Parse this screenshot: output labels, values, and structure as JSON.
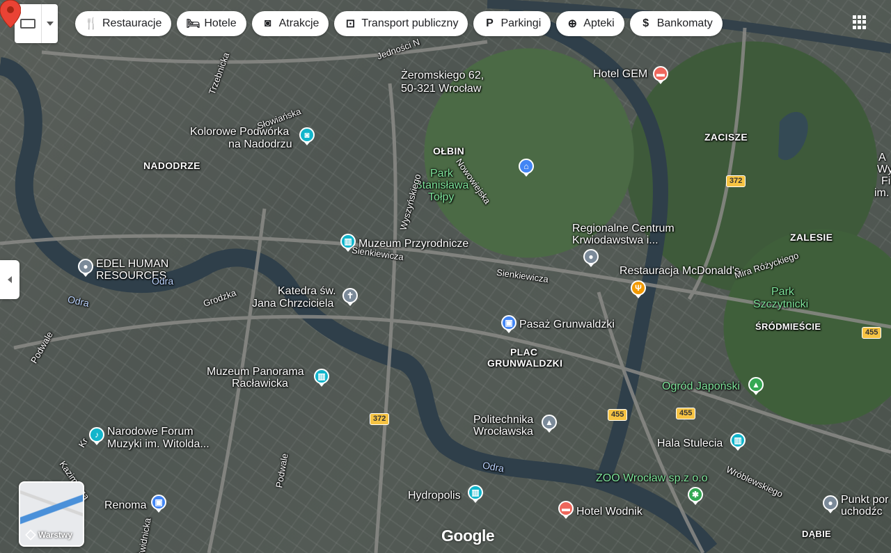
{
  "toolbar": {
    "chips": [
      {
        "label": "Restauracje",
        "icon": "fork-knife-icon",
        "glyph": "🍴"
      },
      {
        "label": "Hotele",
        "icon": "bed-icon",
        "glyph": "🛏"
      },
      {
        "label": "Atrakcje",
        "icon": "camera-icon",
        "glyph": "◙"
      },
      {
        "label": "Transport publiczny",
        "icon": "bus-icon",
        "glyph": "⊡"
      },
      {
        "label": "Parkingi",
        "icon": "parking-icon",
        "glyph": "P"
      },
      {
        "label": "Apteki",
        "icon": "pharmacy-icon",
        "glyph": "⊕"
      },
      {
        "label": "Bankomaty",
        "icon": "atm-icon",
        "glyph": "$"
      }
    ]
  },
  "pin": {
    "line1": "Żeromskiego 62,",
    "line2": "50-321 Wrocław"
  },
  "districts": {
    "nadodrze": "NADODRZE",
    "olbin": "OŁBIN",
    "zacisze": "ZACISZE",
    "zalesie": "ZALESIE",
    "plac1": "PLAC",
    "plac2": "GRUNWALDZKI",
    "srodmiescie": "ŚRÓDMIEŚCIE",
    "dabie": "DĄBIE"
  },
  "places": {
    "hotel_gem": "Hotel GEM",
    "kolorowe1": "Kolorowe Podwórka",
    "kolorowe2": "na Nadodrzu",
    "park_tolpy1": "Park",
    "park_tolpy2": "Stanisława",
    "park_tolpy3": "Tołpy",
    "rckik1": "Regionalne Centrum",
    "rckik2": "Krwiodawstwa i...",
    "muzeum_przyr": "Muzeum Przyrodnicze",
    "edel1": "EDEL HUMAN",
    "edel2": "RESOURCES",
    "mcd": "Restauracja McDonald's",
    "katedra1": "Katedra św.",
    "katedra2": "Jana Chrzciciela",
    "park_szcz1": "Park",
    "park_szcz2": "Szczytnicki",
    "pasaz": "Pasaż Grunwaldzki",
    "panorama1": "Muzeum Panorama",
    "panorama2": "Racławicka",
    "ogrod": "Ogród Japoński",
    "nfm1": "Narodowe Forum",
    "nfm2": "Muzyki im. Witolda...",
    "politechnika1": "Politechnika",
    "politechnika2": "Wrocławska",
    "hala": "Hala Stulecia",
    "zoo": "ZOO Wrocław sp.z o.o",
    "renoma": "Renoma",
    "hydropolis": "Hydropolis",
    "wodnik": "Hotel Wodnik",
    "punkt1": "Punkt por",
    "punkt2": "uchodźc",
    "wyc1": "A",
    "wyc2": "Wy",
    "wyc3": "Fi",
    "wyc4": "im."
  },
  "streets": {
    "jednosci": "Jedności N",
    "trzebnicka": "Trzebnicka",
    "slowianska": "Słowiańska",
    "wyszynskiego": "Wyszyńskiego",
    "nowowiejska": "Nowowiejska",
    "sienkiewicza1": "Sienkiewicza",
    "sienkiewicza2": "Sienkiewicza",
    "grodzka": "Grodzka",
    "podwale1": "Podwale",
    "podwale2": "Podwale",
    "kazimierza": "Kazimierza",
    "swidnicka": "Świdnicka",
    "rozyckiego": "Mira Różyckiego",
    "wroblewskiego": "Wróblewskiego",
    "kruka": "Kr"
  },
  "rivers": {
    "odra1": "Odra",
    "odra2": "Odra",
    "odra3": "Odra"
  },
  "roads": {
    "r372a": "372",
    "r372b": "372",
    "r455a": "455",
    "r455b": "455",
    "r455c": "455"
  },
  "layers": {
    "label": "Warstwy"
  },
  "branding": {
    "google": "Google"
  }
}
